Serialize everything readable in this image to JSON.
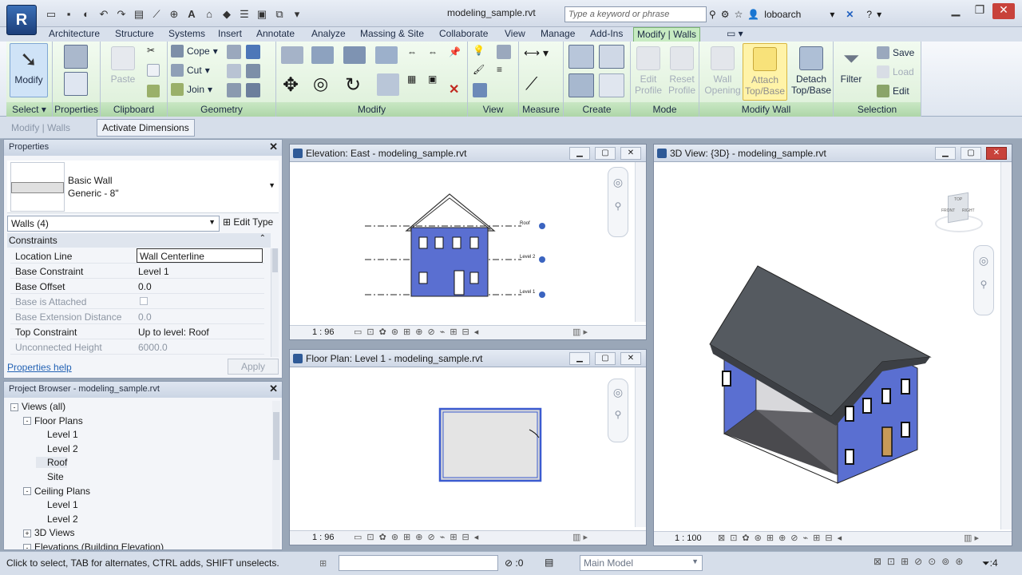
{
  "app": {
    "logo": "R",
    "file_title": "modeling_sample.rvt",
    "search_placeholder": "Type a keyword or phrase",
    "user": "loboarch"
  },
  "tabs": [
    "Architecture",
    "Structure",
    "Systems",
    "Insert",
    "Annotate",
    "Analyze",
    "Massing & Site",
    "Collaborate",
    "View",
    "Manage",
    "Add-Ins",
    "Modify | Walls"
  ],
  "ribbon": {
    "select": {
      "modify_label": "Modify",
      "panel": "Select"
    },
    "properties": {
      "panel": "Properties"
    },
    "clipboard": {
      "paste": "Paste",
      "panel": "Clipboard"
    },
    "geometry": {
      "cope": "Cope",
      "cut": "Cut",
      "join": "Join",
      "panel": "Geometry"
    },
    "modify": {
      "panel": "Modify"
    },
    "view": {
      "panel": "View"
    },
    "measure": {
      "panel": "Measure"
    },
    "create": {
      "panel": "Create"
    },
    "mode": {
      "edit_profile": "Edit Profile",
      "reset_profile": "Reset Profile",
      "panel": "Mode"
    },
    "modify_wall": {
      "wall_opening": "Wall Opening",
      "attach": "Attach Top/Base",
      "detach": "Detach Top/Base",
      "panel": "Modify Wall"
    },
    "selection": {
      "filter": "Filter",
      "save": "Save",
      "load": "Load",
      "edit": "Edit",
      "panel": "Selection"
    }
  },
  "options_bar": {
    "context": "Modify | Walls",
    "activate_dimensions": "Activate Dimensions"
  },
  "properties": {
    "header": "Properties",
    "type_family": "Basic Wall",
    "type_name": "Generic - 8\"",
    "instance_filter": "Walls (4)",
    "edit_type": "Edit Type",
    "group_constraints": "Constraints",
    "rows": [
      {
        "k": "Location Line",
        "v": "Wall Centerline",
        "state": "active"
      },
      {
        "k": "Base Constraint",
        "v": "Level 1",
        "state": "normal"
      },
      {
        "k": "Base Offset",
        "v": "0.0",
        "state": "normal"
      },
      {
        "k": "Base is Attached",
        "v": "",
        "state": "gray"
      },
      {
        "k": "Base Extension Distance",
        "v": "0.0",
        "state": "gray"
      },
      {
        "k": "Top Constraint",
        "v": "Up to level: Roof",
        "state": "normal"
      },
      {
        "k": "Unconnected Height",
        "v": "6000.0",
        "state": "gray"
      }
    ],
    "help_link": "Properties help",
    "apply": "Apply"
  },
  "project_browser": {
    "header": "Project Browser - modeling_sample.rvt",
    "items": [
      {
        "label": "Views (all)",
        "level": 0,
        "toggle": "-"
      },
      {
        "label": "Floor Plans",
        "level": 1,
        "toggle": "-"
      },
      {
        "label": "Level 1",
        "level": 2,
        "toggle": ""
      },
      {
        "label": "Level 2",
        "level": 2,
        "toggle": ""
      },
      {
        "label": "Roof",
        "level": 2,
        "toggle": ""
      },
      {
        "label": "Site",
        "level": 2,
        "toggle": ""
      },
      {
        "label": "Ceiling Plans",
        "level": 1,
        "toggle": "-"
      },
      {
        "label": "Level 1",
        "level": 2,
        "toggle": ""
      },
      {
        "label": "Level 2",
        "level": 2,
        "toggle": ""
      },
      {
        "label": "3D Views",
        "level": 1,
        "toggle": "+"
      },
      {
        "label": "Elevations (Building Elevation)",
        "level": 1,
        "toggle": "-"
      }
    ]
  },
  "views": {
    "elevation": {
      "title": "Elevation: East - modeling_sample.rvt",
      "scale": "1 : 96",
      "levels": [
        "Roof",
        "Level 2",
        "Level 1"
      ]
    },
    "floorplan": {
      "title": "Floor Plan: Level 1 - modeling_sample.rvt",
      "scale": "1 : 96"
    },
    "threed": {
      "title": "3D View: {3D} - modeling_sample.rvt",
      "scale": "1 : 100",
      "cube_labels": [
        "FRONT",
        "RIGHT",
        "TOP"
      ]
    }
  },
  "status_bar": {
    "hint": "Click to select, TAB for alternates, CTRL adds, SHIFT unselects.",
    "selection_count": ":0",
    "model": "Main Model",
    "filter_count": ":4"
  },
  "colors": {
    "wall_blue": "#5a6fd1",
    "contextual_tab": "#c7ebc2",
    "roof_gray": "#555a60"
  }
}
